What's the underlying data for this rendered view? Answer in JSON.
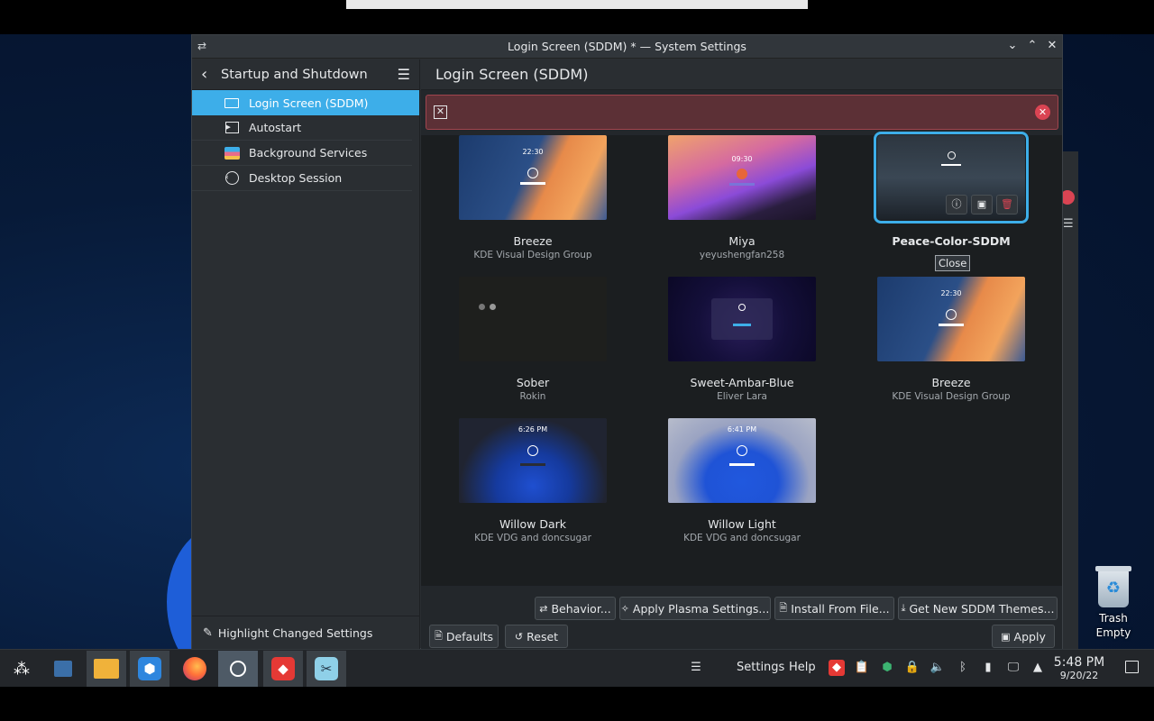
{
  "window": {
    "title": "Login Screen (SDDM) * — System Settings"
  },
  "sidebar": {
    "title": "Startup and Shutdown",
    "items": [
      {
        "label": "Login Screen (SDDM)",
        "icon": "login-screen-icon"
      },
      {
        "label": "Autostart",
        "icon": "autostart-icon"
      },
      {
        "label": "Background Services",
        "icon": "background-services-icon"
      },
      {
        "label": "Desktop Session",
        "icon": "desktop-session-icon"
      }
    ],
    "highlight_label": "Highlight Changed Settings"
  },
  "main": {
    "title": "Login Screen (SDDM)",
    "themes": [
      {
        "name": "Breeze",
        "author": "KDE Visual Design Group",
        "clock": "22:30"
      },
      {
        "name": "Miya",
        "author": "yeyushengfan258",
        "clock": "09:30"
      },
      {
        "name": "Peace-Color-SDDM",
        "author": "",
        "clock": ""
      },
      {
        "name": "Sober",
        "author": "Rokin",
        "clock": ""
      },
      {
        "name": "Sweet-Ambar-Blue",
        "author": "Eliver Lara",
        "clock": ""
      },
      {
        "name": "Breeze",
        "author": "KDE Visual Design Group",
        "clock": "22:30"
      },
      {
        "name": "Willow Dark",
        "author": "KDE VDG and doncsugar",
        "clock": "6:26 PM"
      },
      {
        "name": "Willow Light",
        "author": "KDE VDG and doncsugar",
        "clock": "6:41 PM"
      }
    ],
    "tooltip": "Close",
    "buttons": {
      "behavior": "Behavior...",
      "apply_plasma": "Apply Plasma Settings...",
      "install_file": "Install From File...",
      "get_new": "Get New SDDM Themes...",
      "defaults": "Defaults",
      "reset": "Reset",
      "apply": "Apply"
    }
  },
  "desktop": {
    "trash_label": "Trash",
    "trash_status": "Empty"
  },
  "taskbar": {
    "settings_label": "Settings",
    "help_label": "Help",
    "time": "5:48 PM",
    "date": "9/20/22"
  },
  "colors": {
    "accent": "#3daee9",
    "error": "#da4453",
    "window_bg": "#2a2e32"
  }
}
